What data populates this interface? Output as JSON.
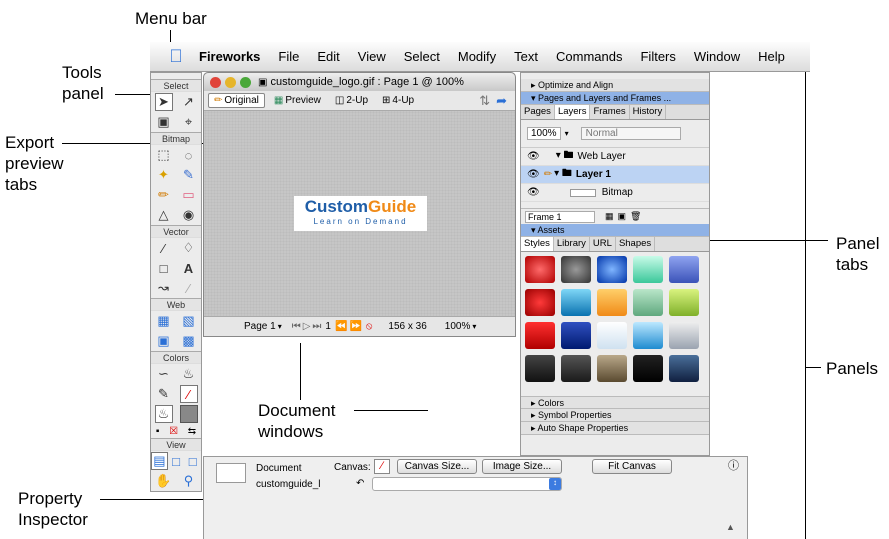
{
  "callouts": {
    "menu_bar": "Menu bar",
    "tools_panel_1": "Tools",
    "tools_panel_2": "panel",
    "export_1": "Export",
    "export_2": "preview",
    "export_3": "tabs",
    "panel_tabs_1": "Panel",
    "panel_tabs_2": "tabs",
    "panels": "Panels",
    "document_1": "Document",
    "document_2": "windows",
    "property_1": "Property",
    "property_2": "Inspector"
  },
  "menubar": {
    "app": "Fireworks",
    "items": [
      "File",
      "Edit",
      "View",
      "Select",
      "Modify",
      "Text",
      "Commands",
      "Filters",
      "Window",
      "Help"
    ]
  },
  "tools": {
    "sections": [
      "Select",
      "Bitmap",
      "Vector",
      "Web",
      "Colors",
      "View"
    ]
  },
  "document": {
    "title": "customguide_logo.gif : Page 1 @ 100%",
    "tabs": [
      "Original",
      "Preview",
      "2-Up",
      "4-Up"
    ],
    "logo_main_1": "Custom",
    "logo_main_2": "Guide",
    "logo_sub": "Learn on Demand",
    "page": "Page 1",
    "frame": "1",
    "size": "156 x 36",
    "zoom": "100%"
  },
  "panels": {
    "optimize": "Optimize and Align",
    "pages_layers": "Pages and Layers and Frames ...",
    "tabs": [
      "Pages",
      "Layers",
      "Frames",
      "History"
    ],
    "opacity": "100%",
    "blend": "Normal",
    "layers": [
      "Web Layer",
      "Layer 1",
      "Bitmap"
    ],
    "frame_select": "Frame 1",
    "assets": "Assets",
    "asset_tabs": [
      "Styles",
      "Library",
      "URL",
      "Shapes"
    ],
    "collapsed": [
      "Colors",
      "Symbol Properties",
      "Auto Shape Properties"
    ]
  },
  "inspector": {
    "type": "Document",
    "filename": "customguide_l",
    "canvas_label": "Canvas:",
    "canvas_size": "Canvas Size...",
    "image_size": "Image Size...",
    "fit_canvas": "Fit Canvas"
  },
  "colors": {
    "accent": "#8fb2e6",
    "logo_blue": "#1f5ea8",
    "logo_orange": "#f08a17"
  }
}
